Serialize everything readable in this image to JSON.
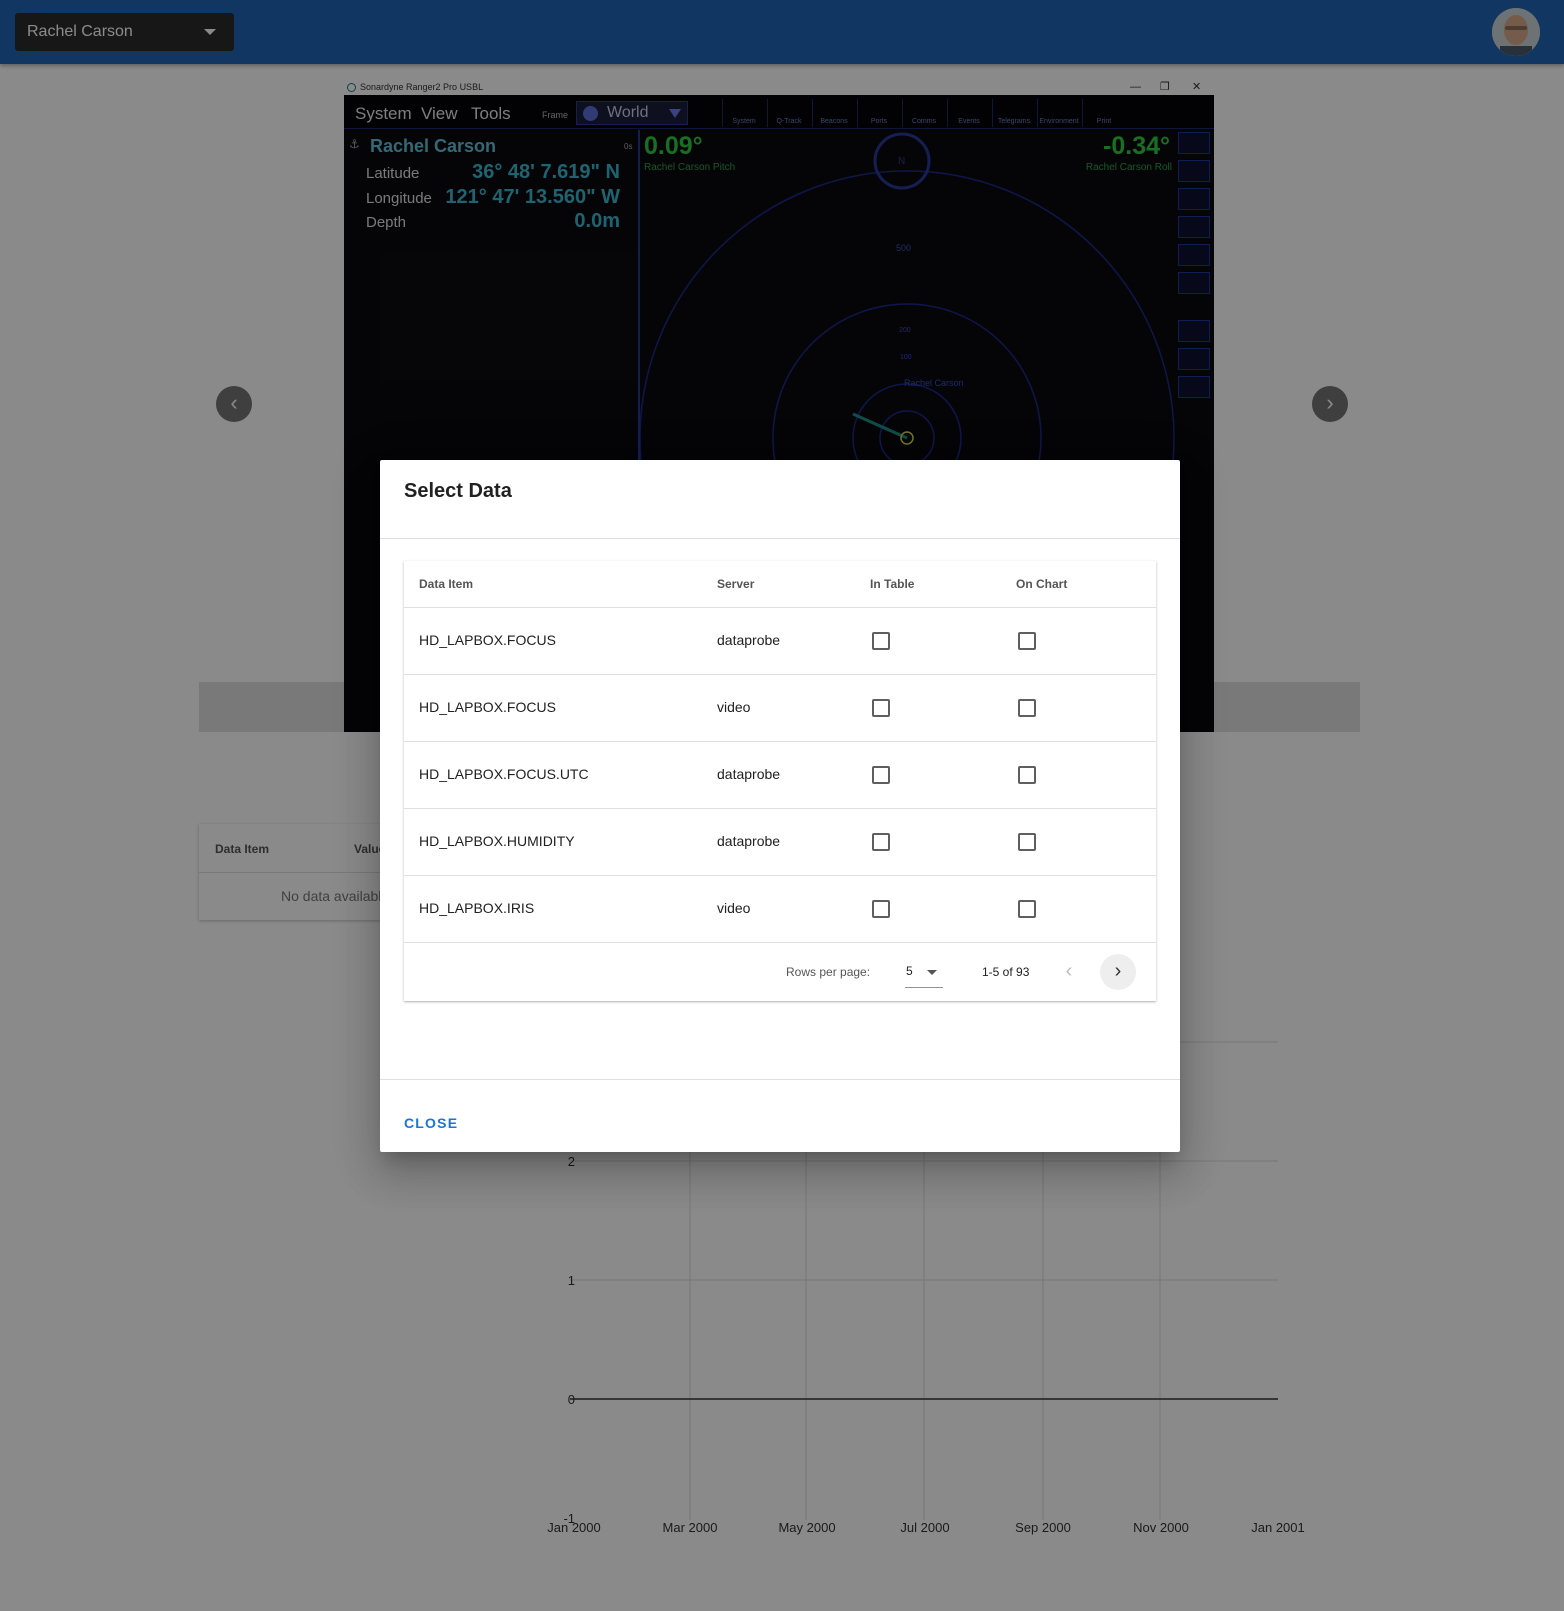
{
  "header": {
    "vessel_select": "Rachel Carson"
  },
  "sonar_window": {
    "title": "Sonardyne Ranger2 Pro USBL",
    "menus": [
      "System",
      "View",
      "Tools"
    ],
    "frame_label": "Frame",
    "frame_value": "World",
    "toolbar": [
      "System",
      "Q-Track",
      "Beacons",
      "Ports",
      "Comms",
      "Events",
      "Telegrams",
      "Environment",
      "Print"
    ],
    "vessel": "Rachel Carson",
    "age": "0s",
    "latitude_label": "Latitude",
    "latitude": "36° 48'  7.619\" N",
    "longitude_label": "Longitude",
    "longitude": "121° 47' 13.560\" W",
    "depth_label": "Depth",
    "depth": "0.0m",
    "pitch": "0.09°",
    "pitch_label": "Rachel Carson Pitch",
    "roll": "-0.34°",
    "roll_label": "Rachel Carson Roll",
    "ring_labels": [
      "500",
      "200",
      "100"
    ],
    "target_label": "Rachel Carson",
    "north_label": "N"
  },
  "background_table": {
    "col_data_item": "Data Item",
    "col_value": "Value",
    "empty": "No data available"
  },
  "background_chart": {
    "y_ticks": [
      "2",
      "1",
      "0",
      "-1"
    ],
    "x_ticks": [
      "Jan 2000",
      "Mar 2000",
      "May 2000",
      "Jul 2000",
      "Sep 2000",
      "Nov 2000",
      "Jan 2001"
    ]
  },
  "dialog": {
    "title": "Select Data",
    "columns": {
      "data_item": "Data Item",
      "server": "Server",
      "in_table": "In Table",
      "on_chart": "On Chart"
    },
    "rows": [
      {
        "item": "HD_LAPBOX.FOCUS",
        "server": "dataprobe",
        "in_table": false,
        "on_chart": false
      },
      {
        "item": "HD_LAPBOX.FOCUS",
        "server": "video",
        "in_table": false,
        "on_chart": false
      },
      {
        "item": "HD_LAPBOX.FOCUS.UTC",
        "server": "dataprobe",
        "in_table": false,
        "on_chart": false
      },
      {
        "item": "HD_LAPBOX.HUMIDITY",
        "server": "dataprobe",
        "in_table": false,
        "on_chart": false
      },
      {
        "item": "HD_LAPBOX.IRIS",
        "server": "video",
        "in_table": false,
        "on_chart": false
      }
    ],
    "pagination": {
      "rows_per_page_label": "Rows per page:",
      "rows_per_page": "5",
      "range": "1-5 of 93"
    },
    "close_label": "CLOSE"
  },
  "colors": {
    "app_bar": "#1f65b4",
    "accent": "#1976d2"
  }
}
